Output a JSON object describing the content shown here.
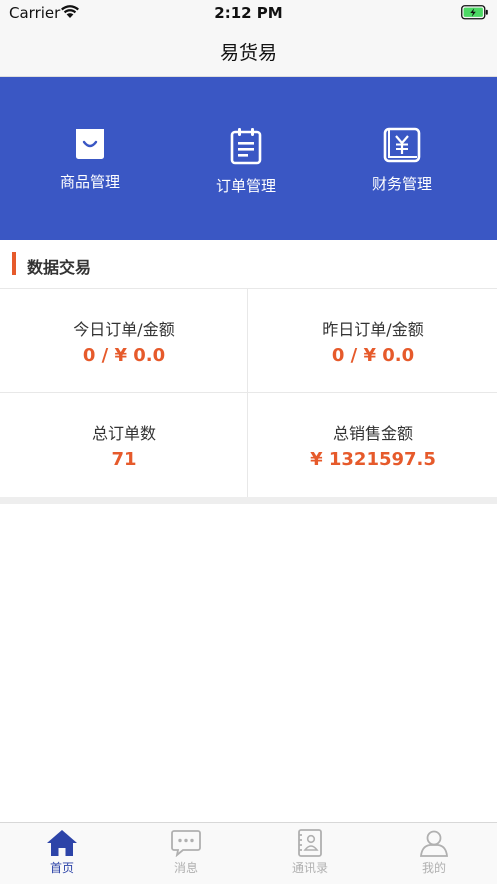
{
  "status_bar": {
    "carrier": "Carrier",
    "time": "2:12 PM"
  },
  "nav": {
    "title": "易货易"
  },
  "banner": {
    "background": "#3a57c4",
    "items": [
      {
        "icon": "shopping-bag-icon",
        "label": "商品管理"
      },
      {
        "icon": "clipboard-icon",
        "label": "订单管理"
      },
      {
        "icon": "yuan-icon",
        "label": "财务管理"
      }
    ]
  },
  "section": {
    "title": "数据交易",
    "accent": "#e65a2b"
  },
  "stats": [
    {
      "label": "今日订单/金额",
      "value": "0 / ¥ 0.0"
    },
    {
      "label": "昨日订单/金额",
      "value": "0 / ¥ 0.0"
    },
    {
      "label": "总订单数",
      "value": "71"
    },
    {
      "label": "总销售金额",
      "value": "¥ 1321597.5"
    }
  ],
  "tab_bar": {
    "active_color": "#2d44a8",
    "inactive_color": "#b0b0b0",
    "tabs": [
      {
        "icon": "home-icon",
        "label": "首页",
        "active": true
      },
      {
        "icon": "message-icon",
        "label": "消息",
        "active": false
      },
      {
        "icon": "contacts-icon",
        "label": "通讯录",
        "active": false
      },
      {
        "icon": "user-icon",
        "label": "我的",
        "active": false
      }
    ]
  }
}
